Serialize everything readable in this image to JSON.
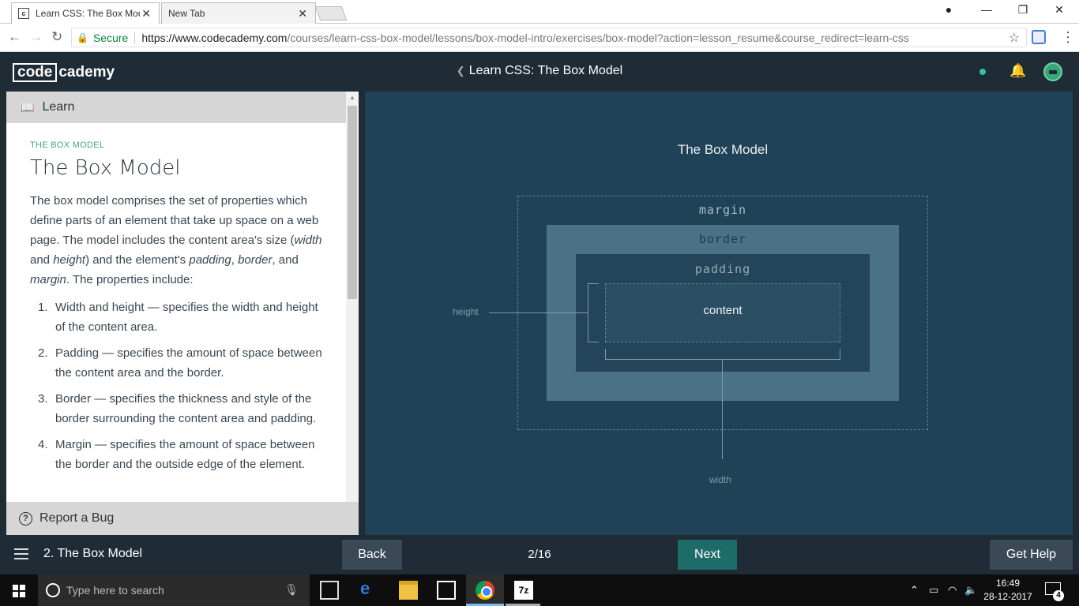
{
  "browser": {
    "tabs": [
      {
        "title": "Learn CSS: The Box Model",
        "favicon": "c"
      },
      {
        "title": "New Tab"
      }
    ],
    "secure_label": "Secure",
    "url_host": "https://www.codecademy.com",
    "url_path": "/courses/learn-css-box-model/lessons/box-model-intro/exercises/box-model?action=lesson_resume&course_redirect=learn-css"
  },
  "header": {
    "logo_boxed": "code",
    "logo_rest": "cademy",
    "course_title": "Learn CSS: The Box Model",
    "status_color": "#2ec4a1"
  },
  "learn_panel": {
    "tab_label": "Learn",
    "eyebrow": "THE BOX MODEL",
    "title": "The Box Model",
    "intro": {
      "p1": "The box model comprises the set of properties which define parts of an element that take up space on a web page. The model includes the content area's size (",
      "em_width": "width",
      "and": " and ",
      "em_height": "height",
      "p2": ") and the element's ",
      "em_padding": "padding",
      "c1": ", ",
      "em_border": "border",
      "c2": ", and ",
      "em_margin": "margin",
      "p3": ". The properties include:"
    },
    "items": [
      {
        "num": "1.",
        "text": "Width and height — specifies the width and height of the content area."
      },
      {
        "num": "2.",
        "text": "Padding — specifies the amount of space between the content area and the border."
      },
      {
        "num": "3.",
        "text": "Border — specifies the thickness and style of the border surrounding the content area and padding."
      },
      {
        "num": "4.",
        "text": "Margin — specifies the amount of space between the border and the outside edge of the element."
      }
    ],
    "report_bug": "Report a Bug"
  },
  "diagram": {
    "title": "The Box Model",
    "margin": "margin",
    "border": "border",
    "padding": "padding",
    "content": "content",
    "height": "height",
    "width": "width"
  },
  "bottom_bar": {
    "lesson": "2. The Box Model",
    "back": "Back",
    "progress": "2/16",
    "next": "Next",
    "help": "Get Help",
    "next_color": "#1e6c69"
  },
  "taskbar": {
    "search_placeholder": "Type here to search",
    "time": "16:49",
    "date": "28-12-2017",
    "notifications": "4",
    "app_7z": "7z"
  }
}
